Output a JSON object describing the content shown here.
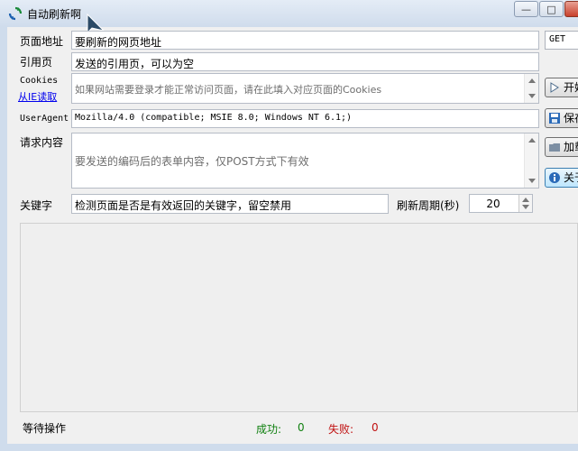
{
  "window": {
    "title": "自动刷新啊",
    "caption_minimize": "—",
    "caption_restore": "□"
  },
  "form": {
    "url_label": "页面地址",
    "url_value": "要刷新的网页地址",
    "referer_label": "引用页",
    "referer_value": "发送的引用页，可以为空",
    "cookies_label": "Cookies",
    "cookies_link": "从IE读取",
    "cookies_value": "如果网站需要登录才能正常访问页面，请在此填入对应页面的Cookies",
    "useragent_label": "UserAgent",
    "useragent_value": "Mozilla/4.0 (compatible; MSIE 8.0; Windows NT 6.1;)",
    "body_label": "请求内容",
    "body_value": "要发送的编码后的表单内容，仅POST方式下有效",
    "keyword_label": "关键字",
    "keyword_value": "检测页面是否是有效返回的关键字，留空禁用",
    "period_label": "刷新周期(秒)",
    "period_value": "20"
  },
  "method": {
    "selected": "GET"
  },
  "buttons": {
    "start": "开始",
    "save": "保存",
    "add": "加载",
    "about": "关于"
  },
  "status": {
    "state": "等待操作",
    "success_label": "成功:",
    "success_value": "0",
    "fail_label": "失败:",
    "fail_value": "0"
  },
  "colors": {
    "success": "#108010",
    "fail": "#c01010",
    "link": "#0000ee"
  }
}
